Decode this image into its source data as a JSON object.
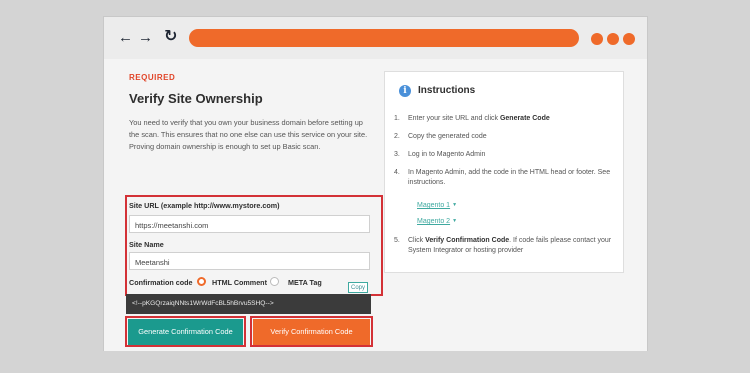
{
  "browser": {
    "back_icon": "arrow-left-icon",
    "forward_icon": "arrow-right-icon",
    "reload_icon": "reload-icon",
    "accent": "#ef6a2a"
  },
  "form": {
    "required_label": "REQUIRED",
    "title": "Verify Site Ownership",
    "description": "You need to verify that you own your business domain before setting up the scan. This ensures that no one else can use this service on your site. Proving domain ownership is enough to set up Basic scan.",
    "site_url_label": "Site URL (example http://www.mystore.com)",
    "site_url_value": "https://meetanshi.com",
    "site_name_label": "Site Name",
    "site_name_value": "Meetanshi",
    "confirmation_label": "Confirmation code",
    "options": [
      "HTML Comment",
      "META Tag"
    ],
    "selected_option": "HTML Comment",
    "copy_label": "Copy",
    "code_value": "<!--pKGQrzaiqNNts1WrWdFcBL5hBrvu5SHQ-->",
    "generate_button": "Generate Confirmation Code",
    "verify_button": "Verify Confirmation Code"
  },
  "instructions": {
    "title": "Instructions",
    "steps": {
      "s1_prefix": "Enter your site URL and click ",
      "s1_bold": "Generate Code",
      "s2": "Copy the generated code",
      "s3": "Log in to Magento Admin",
      "s4": "In Magento Admin, add the code in the HTML head or footer. See instructions.",
      "s5_prefix": "Click ",
      "s5_bold": "Verify Confirmation Code",
      "s5_suffix": ". If code fails please contact your System Integrator or hosting provider"
    },
    "links": [
      "Magento 1",
      "Magento 2"
    ]
  }
}
